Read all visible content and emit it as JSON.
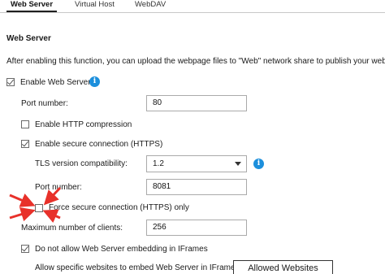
{
  "tabs": [
    {
      "label": "Web Server",
      "active": true
    },
    {
      "label": "Virtual Host",
      "active": false
    },
    {
      "label": "WebDAV",
      "active": false
    }
  ],
  "section_title": "Web Server",
  "description": "After enabling this function, you can upload the webpage files to \"Web\" network share to publish your website.",
  "enable_web_server": {
    "label": "Enable Web Server",
    "checked": true,
    "info_icon": "info-icon"
  },
  "port_number": {
    "label": "Port number:",
    "value": "80"
  },
  "http_compression": {
    "label": "Enable HTTP compression",
    "checked": false
  },
  "https": {
    "label": "Enable secure connection (HTTPS)",
    "checked": true
  },
  "tls": {
    "label": "TLS version compatibility:",
    "value": "1.2"
  },
  "https_port": {
    "label": "Port number:",
    "value": "8081"
  },
  "force_https": {
    "label": "Force secure connection (HTTPS) only",
    "checked": false
  },
  "max_clients": {
    "label": "Maximum number of clients:",
    "value": "256"
  },
  "iframe": {
    "label": "Do not allow Web Server embedding in IFrames",
    "checked": true
  },
  "allow_sites": {
    "label": "Allow specific websites to embed Web Server in IFrames",
    "button": "Allowed Websites"
  },
  "colors": {
    "info_blue": "#1c8fdc",
    "arrow_red": "#e8312a"
  }
}
